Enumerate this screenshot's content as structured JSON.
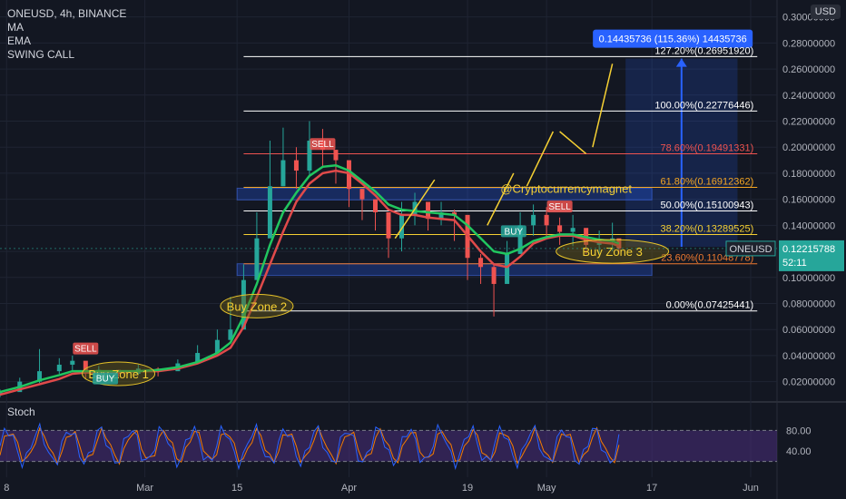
{
  "header": {
    "symbol_line": "ONEUSD, 4h, BINANCE",
    "indicators": [
      "MA",
      "EMA",
      "SWING CALL"
    ],
    "currency_button": "USD"
  },
  "colors": {
    "background": "#131722",
    "grid": "#1f2433",
    "up": "#26a69a",
    "down": "#ef5350",
    "green_ma": "#21c65f",
    "red_ma": "#e04a4a",
    "stoch_k": "#2962ff",
    "stoch_d": "#f57c00",
    "stoch_band": "#4a2d7c"
  },
  "chart_data": {
    "type": "candlestick",
    "symbol": "ONEUSD",
    "interval": "4h",
    "exchange": "BINANCE",
    "y_axis": {
      "ticks": [
        "0.30000000",
        "0.28000000",
        "0.26000000",
        "0.24000000",
        "0.22000000",
        "0.20000000",
        "0.18000000",
        "0.16000000",
        "0.14000000",
        "0.12000000",
        "0.10000000",
        "0.08000000",
        "0.06000000",
        "0.04000000",
        "0.02000000"
      ],
      "tick_values": [
        0.3,
        0.28,
        0.26,
        0.24,
        0.22,
        0.2,
        0.18,
        0.16,
        0.14,
        0.12,
        0.1,
        0.08,
        0.06,
        0.04,
        0.02
      ],
      "ylim": [
        0.0065,
        0.313
      ]
    },
    "x_axis": {
      "ticks": [
        "8",
        "Mar",
        "15",
        "Apr",
        "19",
        "May",
        "17",
        "Jun"
      ],
      "tick_dates": [
        "2021-02-08",
        "2021-03-01",
        "2021-03-15",
        "2021-04-01",
        "2021-04-19",
        "2021-05-01",
        "2021-05-17",
        "2021-06-01"
      ],
      "xlim": [
        "2021-02-07",
        "2021-06-05"
      ]
    },
    "price_series": {
      "name": "ONEUSD",
      "dates": [
        "2021-02-07",
        "2021-02-10",
        "2021-02-13",
        "2021-02-16",
        "2021-02-18",
        "2021-02-20",
        "2021-02-22",
        "2021-02-25",
        "2021-02-28",
        "2021-03-03",
        "2021-03-06",
        "2021-03-09",
        "2021-03-12",
        "2021-03-14",
        "2021-03-16",
        "2021-03-18",
        "2021-03-20",
        "2021-03-22",
        "2021-03-24",
        "2021-03-26",
        "2021-03-28",
        "2021-03-30",
        "2021-04-01",
        "2021-04-03",
        "2021-04-05",
        "2021-04-07",
        "2021-04-09",
        "2021-04-11",
        "2021-04-13",
        "2021-04-15",
        "2021-04-17",
        "2021-04-19",
        "2021-04-21",
        "2021-04-23",
        "2021-04-25",
        "2021-04-27",
        "2021-04-29",
        "2021-05-01",
        "2021-05-03",
        "2021-05-05",
        "2021-05-07",
        "2021-05-09",
        "2021-05-11",
        "2021-05-12"
      ],
      "close": [
        0.012,
        0.02,
        0.028,
        0.033,
        0.036,
        0.027,
        0.029,
        0.026,
        0.03,
        0.028,
        0.034,
        0.042,
        0.052,
        0.06,
        0.098,
        0.13,
        0.17,
        0.19,
        0.182,
        0.205,
        0.198,
        0.19,
        0.168,
        0.16,
        0.15,
        0.13,
        0.148,
        0.158,
        0.145,
        0.15,
        0.148,
        0.115,
        0.108,
        0.095,
        0.118,
        0.14,
        0.148,
        0.14,
        0.135,
        0.138,
        0.125,
        0.128,
        0.13,
        0.1222
      ],
      "high": [
        0.014,
        0.023,
        0.045,
        0.038,
        0.04,
        0.031,
        0.032,
        0.029,
        0.033,
        0.031,
        0.037,
        0.048,
        0.06,
        0.085,
        0.11,
        0.15,
        0.205,
        0.215,
        0.2,
        0.22,
        0.214,
        0.198,
        0.18,
        0.168,
        0.158,
        0.142,
        0.158,
        0.165,
        0.155,
        0.158,
        0.152,
        0.128,
        0.118,
        0.11,
        0.128,
        0.15,
        0.156,
        0.154,
        0.146,
        0.148,
        0.136,
        0.136,
        0.142,
        0.126
      ],
      "low": [
        0.008,
        0.014,
        0.019,
        0.026,
        0.028,
        0.022,
        0.024,
        0.023,
        0.025,
        0.024,
        0.029,
        0.036,
        0.046,
        0.052,
        0.07,
        0.098,
        0.132,
        0.17,
        0.168,
        0.178,
        0.185,
        0.172,
        0.154,
        0.144,
        0.136,
        0.115,
        0.12,
        0.14,
        0.136,
        0.14,
        0.128,
        0.098,
        0.095,
        0.07,
        0.098,
        0.118,
        0.132,
        0.13,
        0.125,
        0.124,
        0.118,
        0.118,
        0.12,
        0.118
      ],
      "last_price": "0.12215788",
      "countdown": "52:11"
    },
    "moving_averages": [
      {
        "name": "MA",
        "values": [
          0.01,
          0.014,
          0.018,
          0.022,
          0.026,
          0.027,
          0.027,
          0.027,
          0.028,
          0.028,
          0.03,
          0.034,
          0.04,
          0.046,
          0.062,
          0.085,
          0.11,
          0.135,
          0.158,
          0.172,
          0.18,
          0.182,
          0.18,
          0.172,
          0.163,
          0.152,
          0.148,
          0.148,
          0.146,
          0.145,
          0.144,
          0.132,
          0.12,
          0.11,
          0.108,
          0.116,
          0.126,
          0.13,
          0.132,
          0.132,
          0.129,
          0.127,
          0.126,
          0.124
        ]
      },
      {
        "name": "EMA",
        "values": [
          0.012,
          0.016,
          0.021,
          0.025,
          0.028,
          0.028,
          0.028,
          0.028,
          0.028,
          0.029,
          0.031,
          0.035,
          0.042,
          0.05,
          0.07,
          0.095,
          0.125,
          0.15,
          0.165,
          0.178,
          0.185,
          0.186,
          0.182,
          0.174,
          0.166,
          0.156,
          0.152,
          0.151,
          0.15,
          0.149,
          0.148,
          0.14,
          0.13,
          0.12,
          0.118,
          0.122,
          0.128,
          0.131,
          0.133,
          0.133,
          0.131,
          0.129,
          0.128,
          0.126
        ]
      }
    ],
    "fibonacci": {
      "levels": [
        {
          "label": "127.20%(0.26951920)",
          "value": 0.2695192,
          "color": "#ffffff"
        },
        {
          "label": "100.00%(0.22776446)",
          "value": 0.22776446,
          "color": "#ffffff"
        },
        {
          "label": "78.60%(0.19491331)",
          "value": 0.19491331,
          "color": "#ef5350"
        },
        {
          "label": "61.80%(0.16912362)",
          "value": 0.16912362,
          "color": "#f5a623"
        },
        {
          "label": "50.00%(0.15100943)",
          "value": 0.15100943,
          "color": "#ffffff"
        },
        {
          "label": "38.20%(0.13289525)",
          "value": 0.13289525,
          "color": "#f5d033"
        },
        {
          "label": "23.60%(0.11048778)",
          "value": 0.11048778,
          "color": "#ef7a30"
        },
        {
          "label": "0.00%(0.07425441)",
          "value": 0.07425441,
          "color": "#ffffff"
        }
      ]
    },
    "zones": [
      {
        "y_range": [
          0.1595,
          0.1685
        ]
      },
      {
        "y_range": [
          0.1015,
          0.1105
        ]
      }
    ],
    "measure": {
      "label": "0.14435736 (115.36%) 14435736",
      "from_value": 0.1235,
      "to_value": 0.268
    },
    "annotations": {
      "buy_zones": [
        "Buy Zone 1",
        "Buy Zone 2",
        "Buy Zone 3"
      ],
      "signals": [
        "SELL",
        "BUY",
        "SELL",
        "BUY",
        "SELL"
      ],
      "watermark": "@Cryptocurrencymagnet"
    }
  },
  "stoch": {
    "label": "Stoch",
    "ticks": [
      "80.00",
      "40.00"
    ],
    "tick_values": [
      80,
      40
    ],
    "ylim": [
      0,
      100
    ],
    "band": [
      20,
      80
    ]
  }
}
